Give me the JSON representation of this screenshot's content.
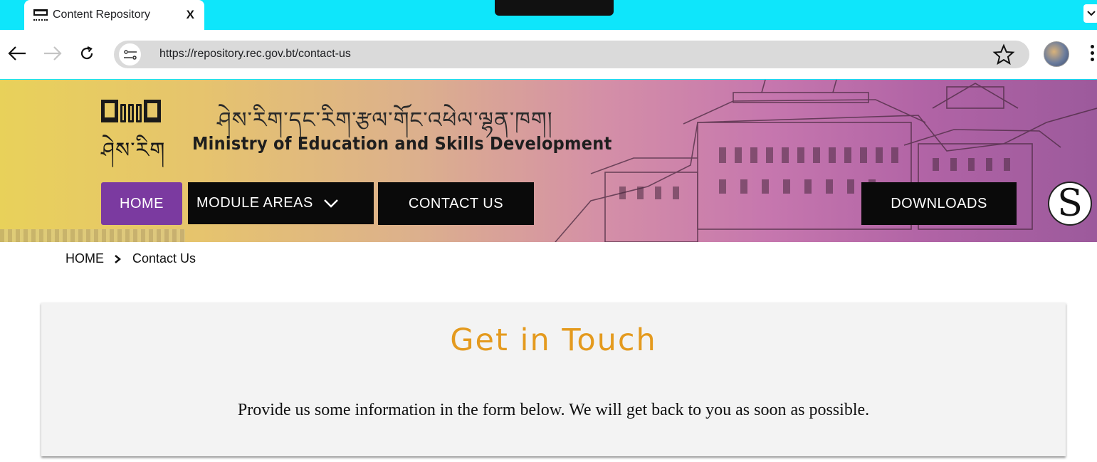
{
  "browser": {
    "tab_title": "Content Repository",
    "tab_close": "X",
    "url": "https://repository.rec.gov.bt/contact-us"
  },
  "site": {
    "logo_text": "ཤེས་རིག",
    "dzongkha_name": "ཤེས་རིག་དང་རིག་རྩལ་གོང་འཕེལ་ལྷན་ཁག།",
    "ministry_name": "Ministry of Education and Skills Development",
    "badge_letter": "S",
    "nav": {
      "home": "HOME",
      "module_areas": "MODULE AREAS",
      "contact_us": "CONTACT US",
      "downloads": "DOWNLOADS"
    }
  },
  "breadcrumb": {
    "home": "HOME",
    "current": "Contact Us"
  },
  "contact": {
    "title": "Get in Touch",
    "description": "Provide us some information in the form below. We will get back to you as soon as possible."
  },
  "colors": {
    "tabbar": "#0ee6fb",
    "nav_active": "#7b3aa0",
    "nav_default": "#0a0a0a",
    "title_accent": "#e49a1e"
  }
}
